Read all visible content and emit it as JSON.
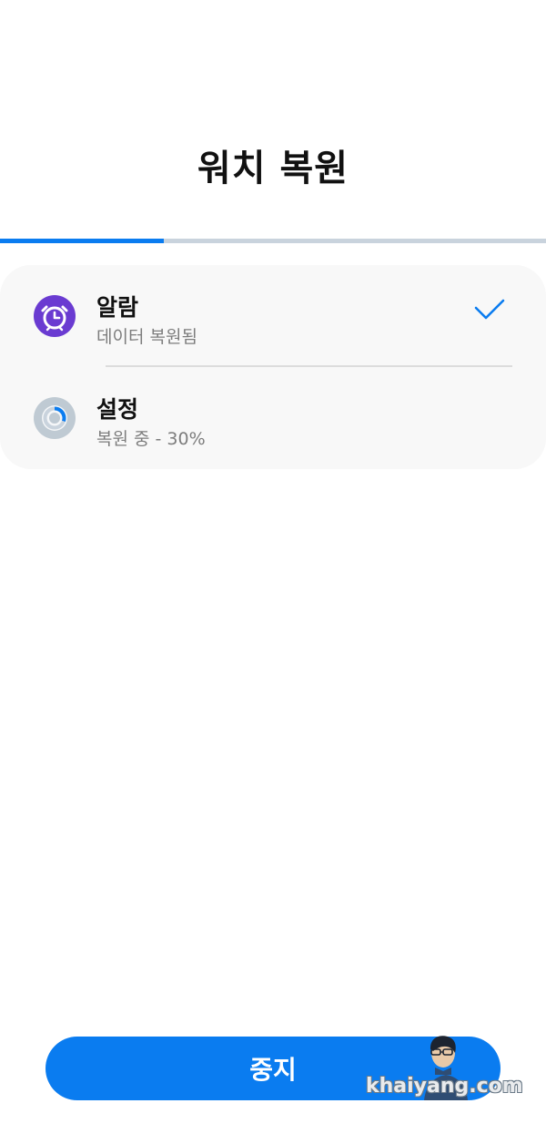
{
  "header": {
    "title": "워치 복원"
  },
  "progress": {
    "value": 0.3
  },
  "items": [
    {
      "title": "알람",
      "status": "데이터 복원됨",
      "icon": "alarm-clock-icon",
      "done": true
    },
    {
      "title": "설정",
      "status": "복원 중 - 30%",
      "icon": "progress-ring-icon",
      "done": false,
      "progress": 0.3
    }
  ],
  "footer": {
    "stop_label": "중지"
  },
  "watermark": {
    "text": "khaiyang.com"
  },
  "colors": {
    "accent": "#0a7cf0",
    "alarm": "#6a3bd1",
    "track": "#c9d3dd"
  }
}
